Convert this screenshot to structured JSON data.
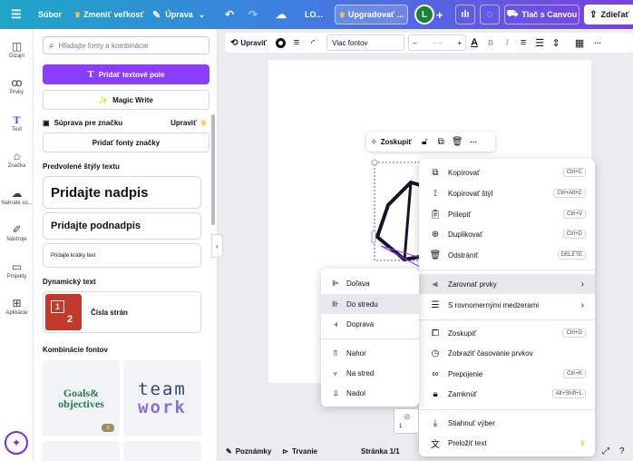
{
  "topbar": {
    "file": "Súbor",
    "resize": "Zmeniť veľkosť",
    "edit": "Úprava",
    "doc_title": "LO...",
    "upgrade": "Upgradovať ...",
    "avatar": "L",
    "print": "Tlač s Canvou",
    "share": "Zdieľať"
  },
  "rail": {
    "items": [
      {
        "label": "Dizajn",
        "icon": "layout-icon"
      },
      {
        "label": "Prvky",
        "icon": "shapes-icon"
      },
      {
        "label": "Text",
        "icon": "text-icon"
      },
      {
        "label": "Značka",
        "icon": "brand-icon"
      },
      {
        "label": "Nahraté sú...",
        "icon": "upload-icon"
      },
      {
        "label": "Nástroje",
        "icon": "draw-icon"
      },
      {
        "label": "Projekty",
        "icon": "folder-icon"
      },
      {
        "label": "Aplikácie",
        "icon": "apps-icon"
      }
    ]
  },
  "panel": {
    "search_placeholder": "Hľadajte fonty a kombinácie",
    "add_text": "Pridať textové pole",
    "magic_write": "Magic Write",
    "brand_kit": "Súprava pre značku",
    "brand_edit": "Upraviť",
    "add_brand_fonts": "Pridať fonty značky",
    "default_styles_title": "Predvolené štýly textu",
    "heading": "Pridajte nadpis",
    "subheading": "Pridajte podnadpis",
    "body": "Pridajte krátky text",
    "dynamic_title": "Dynamický text",
    "page_numbers": "Čísla strán",
    "page_numbers_thumb_a": "1",
    "page_numbers_thumb_b": "2",
    "combos_title": "Kombinácie fontov",
    "combo1_line1": "Goals&",
    "combo1_line2": "objectives",
    "combo2_line1": "team",
    "combo2_line2": "work"
  },
  "toolbar": {
    "edit": "Upraviť",
    "font": "Viac fontov",
    "font_size": "– –"
  },
  "selection_toolbar": {
    "group": "Zoskupiť"
  },
  "context_menu": {
    "items": [
      {
        "label": "Kopírovať",
        "shortcut": "Ctrl+C",
        "icon": "copy-icon"
      },
      {
        "label": "Kopírovať štýl",
        "shortcut": "Ctrl+Alt+C",
        "icon": "paint-roller-icon"
      },
      {
        "label": "Prilepiť",
        "shortcut": "Ctrl+V",
        "icon": "paste-icon"
      },
      {
        "label": "Duplikovať",
        "shortcut": "Ctrl+D",
        "icon": "duplicate-icon"
      },
      {
        "label": "Odstrániť",
        "shortcut": "DELETE",
        "icon": "trash-icon"
      },
      {
        "label": "Zarovnať prvky",
        "icon": "align-icon"
      },
      {
        "label": "S rovnomernými medzerami",
        "icon": "spacing-icon"
      },
      {
        "label": "Zoskupiť",
        "shortcut": "Ctrl+G",
        "icon": "group-icon"
      },
      {
        "label": "Zobraziť časovanie prvkov",
        "icon": "clock-icon"
      },
      {
        "label": "Prepojenie",
        "shortcut": "Ctrl+K",
        "icon": "link-icon"
      },
      {
        "label": "Zamknúť",
        "shortcut": "Alt+Shift+L",
        "icon": "lock-icon"
      },
      {
        "label": "Stiahnuť výber",
        "icon": "download-icon"
      },
      {
        "label": "Preložiť text",
        "icon": "translate-icon"
      }
    ]
  },
  "align_submenu": {
    "items": [
      {
        "label": "Doľava",
        "icon": "align-left-icon"
      },
      {
        "label": "Do stredu",
        "icon": "align-center-icon"
      },
      {
        "label": "Doprava",
        "icon": "align-right-icon"
      },
      {
        "label": "Nahor",
        "icon": "align-top-icon"
      },
      {
        "label": "Na stred",
        "icon": "align-middle-icon"
      },
      {
        "label": "Nadol",
        "icon": "align-bottom-icon"
      }
    ]
  },
  "footer": {
    "notes": "Poznámky",
    "duration": "Trvanie",
    "page": "Stránka 1/1"
  },
  "page_thumb": "1"
}
